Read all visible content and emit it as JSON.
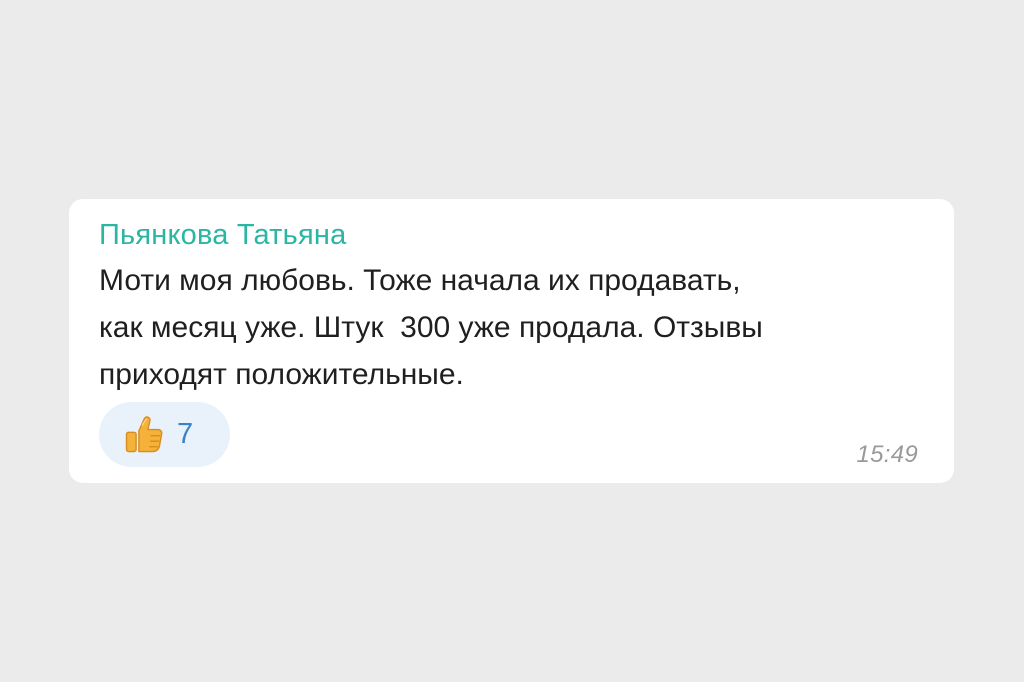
{
  "message": {
    "sender": "Пьянкова Татьяна",
    "text": "Моти моя любовь. Тоже начала их продавать,\nкак месяц уже. Штук  300 уже продала. Отзывы\nприходят положительные.",
    "time": "15:49"
  },
  "reaction": {
    "icon": "thumbs-up-icon",
    "count": "7"
  },
  "colors": {
    "background": "#ebebeb",
    "bubble": "#ffffff",
    "sender": "#2bb6a4",
    "reaction_bg": "#e9f1fb",
    "reaction_count": "#3a82c8",
    "time": "#9a9a9a"
  }
}
